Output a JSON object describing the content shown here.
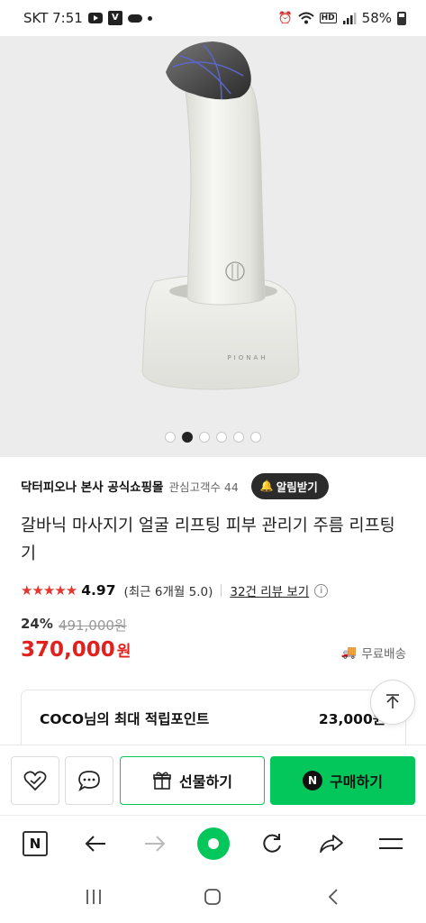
{
  "status_bar": {
    "carrier_time": "SKT 7:51",
    "battery": "58%"
  },
  "gallery": {
    "slide_count": 6,
    "active_index": 1,
    "product_brand_text": "PIONAH"
  },
  "shop": {
    "name": "닥터피오나 본사 공식쇼핑몰",
    "favorites": "관심고객수 44",
    "alarm_label": "알림받기"
  },
  "product": {
    "title": "갈바닉 마사지기 얼굴 리프팅 피부 관리기 주름 리프팅기"
  },
  "rating": {
    "stars": "★★★★★",
    "score": "4.97",
    "recent": "(최근 6개월 5.0)",
    "reviews": "32건 리뷰 보기"
  },
  "price": {
    "discount": "24%",
    "original": "491,000원",
    "sale": "370,000",
    "currency": "원",
    "shipping": "무료배송"
  },
  "points": {
    "label": "COCO님의 최대 적립포인트",
    "value": "23,000원"
  },
  "actions": {
    "gift_label": "선물하기",
    "buy_label": "구매하기",
    "buy_logo": "N"
  },
  "browser": {
    "logo": "N"
  },
  "colors": {
    "naver_green": "#03c75a",
    "price_red": "#e0211d",
    "star_red": "#e5352f"
  }
}
